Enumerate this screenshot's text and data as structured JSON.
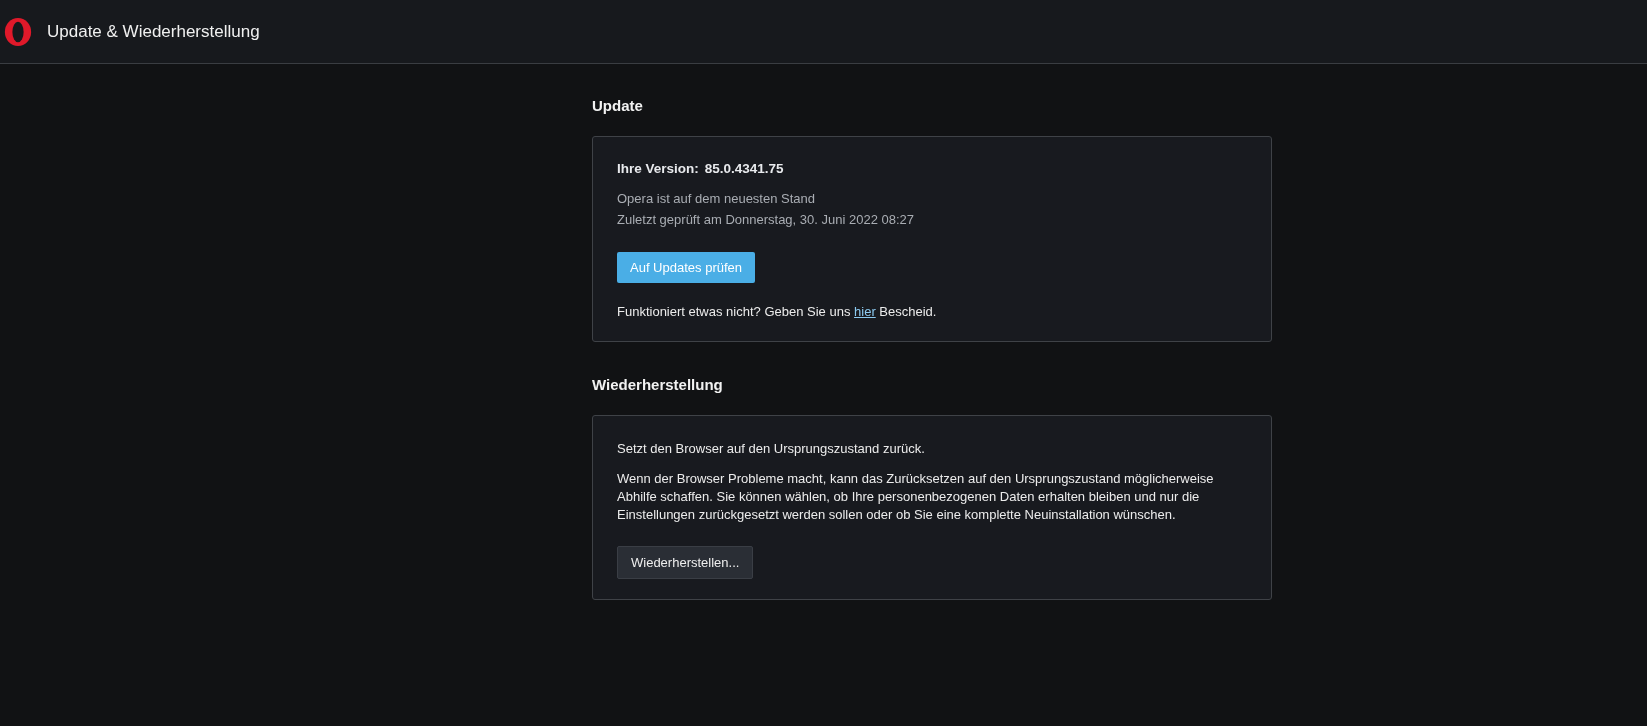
{
  "header": {
    "title": "Update & Wiederherstellung"
  },
  "update": {
    "heading": "Update",
    "version_label": "Ihre Version:",
    "version": "85.0.4341.75",
    "status": "Opera ist auf dem neuesten Stand",
    "last_checked": "Zuletzt geprüft am Donnerstag, 30. Juni 2022 08:27",
    "button": "Auf Updates prüfen",
    "feedback": {
      "before": "Funktioniert etwas nicht? Geben Sie uns",
      "link": "hier",
      "after": "Bescheid."
    }
  },
  "restore": {
    "heading": "Wiederherstellung",
    "summary": "Setzt den Browser auf den Ursprungszustand zurück.",
    "description": "Wenn der Browser Probleme macht, kann das Zurücksetzen auf den Ursprungszustand möglicherweise Abhilfe schaffen. Sie können wählen, ob Ihre personenbezogenen Daten erhalten bleiben und nur die Einstellungen zurückgesetzt werden sollen oder ob Sie eine komplette Neuinstallation wünschen.",
    "button": "Wiederherstellen..."
  }
}
